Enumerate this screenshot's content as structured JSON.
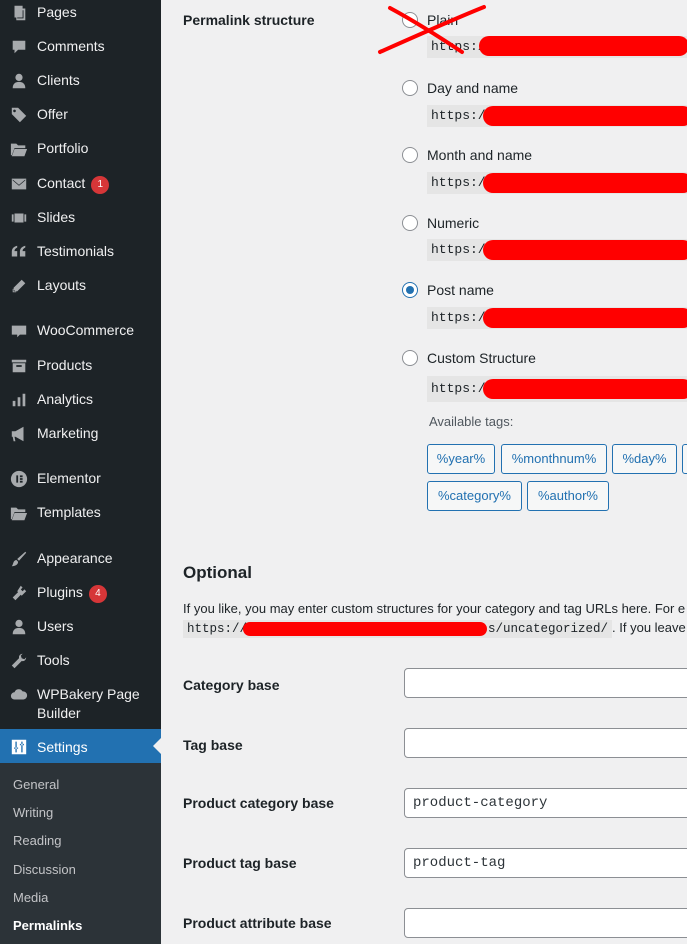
{
  "sidebar": {
    "items": [
      {
        "label": "Pages",
        "icon": "pages-icon"
      },
      {
        "label": "Comments",
        "icon": "comments-icon"
      },
      {
        "label": "Clients",
        "icon": "clients-icon"
      },
      {
        "label": "Offer",
        "icon": "offer-tag-icon"
      },
      {
        "label": "Portfolio",
        "icon": "portfolio-folder-icon"
      },
      {
        "label": "Contact",
        "icon": "contact-envelope-icon",
        "badge": "1"
      },
      {
        "label": "Slides",
        "icon": "slides-icon"
      },
      {
        "label": "Testimonials",
        "icon": "testimonials-quote-icon"
      },
      {
        "label": "Layouts",
        "icon": "layouts-pencil-icon"
      },
      {
        "label": "WooCommerce",
        "icon": "woocommerce-icon"
      },
      {
        "label": "Products",
        "icon": "products-icon"
      },
      {
        "label": "Analytics",
        "icon": "analytics-bars-icon"
      },
      {
        "label": "Marketing",
        "icon": "marketing-megaphone-icon"
      },
      {
        "label": "Elementor",
        "icon": "elementor-icon"
      },
      {
        "label": "Templates",
        "icon": "templates-folder-icon"
      },
      {
        "label": "Appearance",
        "icon": "appearance-brush-icon"
      },
      {
        "label": "Plugins",
        "icon": "plugins-icon",
        "badge": "4"
      },
      {
        "label": "Users",
        "icon": "users-icon"
      },
      {
        "label": "Tools",
        "icon": "tools-wrench-icon"
      },
      {
        "label": "WPBakery Page Builder",
        "label_line1": "WPBakery Page",
        "label_line2": "Builder",
        "icon": "wpbakery-cloud-icon"
      },
      {
        "label": "Settings",
        "icon": "settings-sliders-icon",
        "active": true
      }
    ],
    "submenu": [
      {
        "label": "General"
      },
      {
        "label": "Writing"
      },
      {
        "label": "Reading"
      },
      {
        "label": "Discussion"
      },
      {
        "label": "Media"
      },
      {
        "label": "Permalinks",
        "current": true
      }
    ]
  },
  "permalink": {
    "label": "Permalink structure",
    "options": [
      {
        "label": "Plain",
        "code": "https://",
        "checked": false
      },
      {
        "label": "Day and name",
        "code": "https://",
        "checked": false
      },
      {
        "label": "Month and name",
        "code": "https://",
        "checked": false
      },
      {
        "label": "Numeric",
        "code": "https://",
        "checked": false
      },
      {
        "label": "Post name",
        "code": "https://",
        "checked": true
      },
      {
        "label": "Custom Structure",
        "code": "https://",
        "checked": false
      }
    ],
    "available_tags_label": "Available tags:",
    "tags": [
      "%year%",
      "%monthnum%",
      "%day%",
      "%category%",
      "%author%"
    ]
  },
  "optional": {
    "title": "Optional",
    "description": "If you like, you may enter custom structures for your category and tag URLs here. For e",
    "code_prefix": "https://",
    "code_suffix": "s/uncategorized/",
    "after_code": ". If you leave th",
    "fields": [
      {
        "label": "Category base",
        "value": ""
      },
      {
        "label": "Tag base",
        "value": ""
      },
      {
        "label": "Product category base",
        "value": "product-category"
      },
      {
        "label": "Product tag base",
        "value": "product-tag"
      },
      {
        "label": "Product attribute base",
        "value": ""
      }
    ]
  },
  "colors": {
    "sidebar_bg": "#1d2327",
    "accent": "#2271b1",
    "redaction": "#ff0000",
    "badge": "#d63638"
  }
}
